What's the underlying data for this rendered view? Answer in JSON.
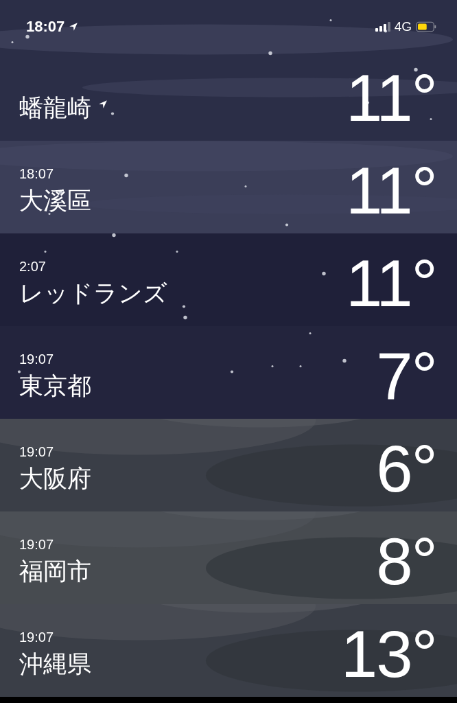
{
  "status_bar": {
    "time": "18:07",
    "network": "4G"
  },
  "locations": [
    {
      "name": "蟠龍崎",
      "current": true,
      "temperature": "11°",
      "kind": "haze"
    },
    {
      "local_time": "18:07",
      "name": "大溪區",
      "current": false,
      "temperature": "11°",
      "kind": "haze"
    },
    {
      "local_time": "2:07",
      "name": "レッドランズ",
      "current": false,
      "temperature": "11°",
      "kind": "stars"
    },
    {
      "local_time": "19:07",
      "name": "東京都",
      "current": false,
      "temperature": "7°",
      "kind": "stars"
    },
    {
      "local_time": "19:07",
      "name": "大阪府",
      "current": false,
      "temperature": "6°",
      "kind": "clouds"
    },
    {
      "local_time": "19:07",
      "name": "福岡市",
      "current": false,
      "temperature": "8°",
      "kind": "clouds"
    },
    {
      "local_time": "19:07",
      "name": "沖縄県",
      "current": false,
      "temperature": "13°",
      "kind": "clouds"
    }
  ]
}
